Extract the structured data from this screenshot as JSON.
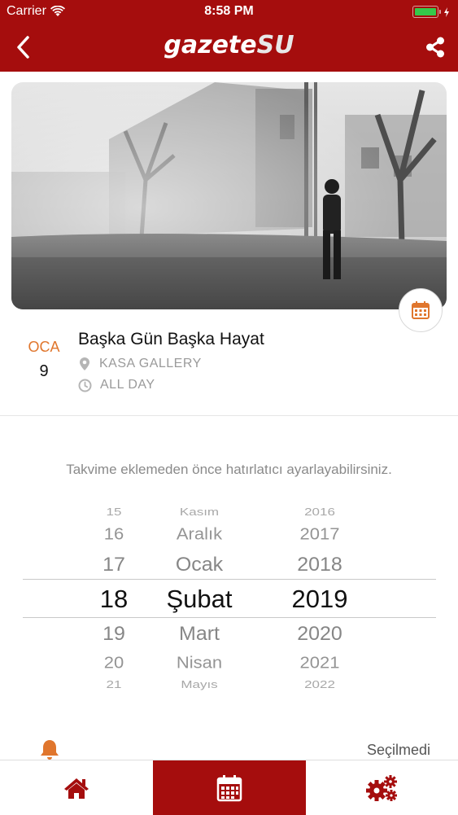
{
  "status_bar": {
    "carrier": "Carrier",
    "time": "8:58 PM"
  },
  "nav": {
    "logo_main": "gazete",
    "logo_accent": "SU",
    "back_icon": "chevron-left-icon",
    "share_icon": "share-icon"
  },
  "event": {
    "month": "OCA",
    "day": "9",
    "title": "Başka Gün Başka Hayat",
    "location": "KASA GALLERY",
    "time": "ALL DAY"
  },
  "reminder_hint": "Takvime eklemeden önce hatırlatıcı ayarlayabilirsiniz.",
  "picker": {
    "days": [
      "15",
      "16",
      "17",
      "18",
      "19",
      "20",
      "21"
    ],
    "months": [
      "Kasım",
      "Aralık",
      "Ocak",
      "Şubat",
      "Mart",
      "Nisan",
      "Mayıs"
    ],
    "years": [
      "2016",
      "2017",
      "2018",
      "2019",
      "2020",
      "2021",
      "2022"
    ],
    "selected": {
      "day": "18",
      "month": "Şubat",
      "year": "2019"
    }
  },
  "reminder_status": "Seçilmedi",
  "tabs": [
    {
      "name": "home",
      "icon": "home-icon"
    },
    {
      "name": "calendar",
      "icon": "calendar-icon",
      "active": true
    },
    {
      "name": "settings",
      "icon": "gears-icon"
    }
  ],
  "colors": {
    "brand_red": "#a50d0d",
    "accent_orange": "#e0762d"
  }
}
